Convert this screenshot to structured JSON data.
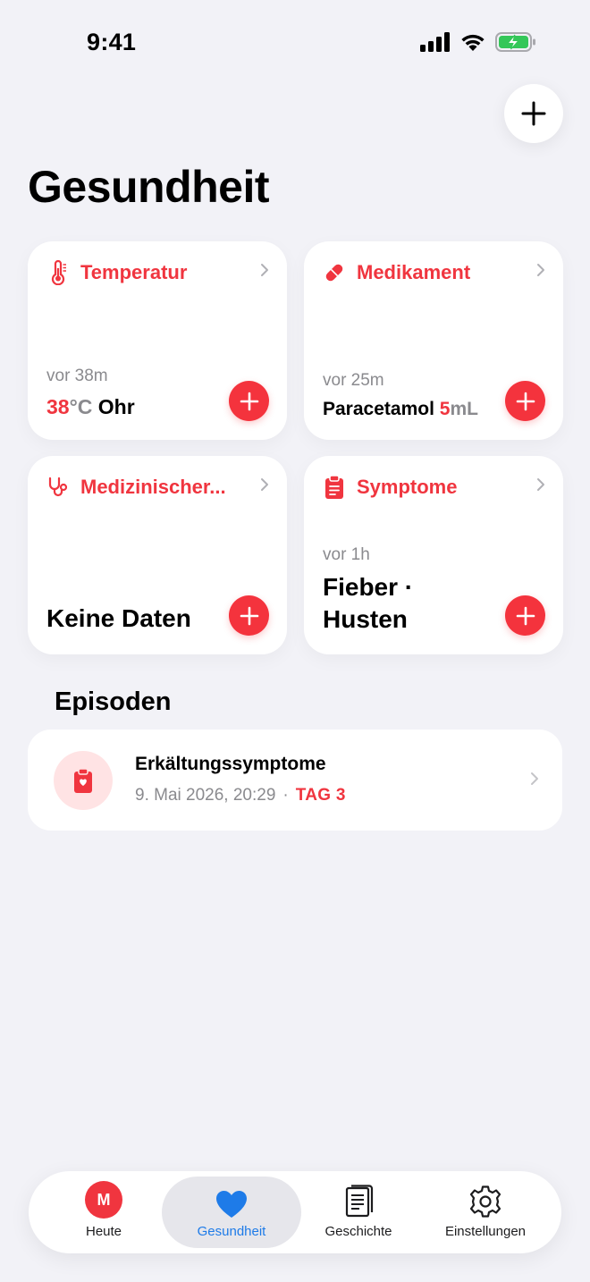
{
  "status_bar": {
    "time": "9:41"
  },
  "header": {
    "title": "Gesundheit"
  },
  "cards": [
    {
      "title": "Temperatur",
      "time": "vor 38m",
      "value_number": "38",
      "value_unit": "°C",
      "value_location": "Ohr"
    },
    {
      "title": "Medikament",
      "time": "vor 25m",
      "value_name": "Paracetamol",
      "value_amount": "5",
      "value_unit": "mL"
    },
    {
      "title": "Medizinischer...",
      "value_text": "Keine Daten"
    },
    {
      "title": "Symptome",
      "time": "vor 1h",
      "value_line1": "Fieber ·",
      "value_line2": "Husten"
    }
  ],
  "episodes": {
    "title": "Episoden",
    "items": [
      {
        "title": "Erkältungssymptome",
        "date": "9. Mai 2026, 20:29",
        "separator": "·",
        "day": "TAG 3"
      }
    ]
  },
  "tabbar": {
    "items": [
      {
        "label": "Heute",
        "avatar_letter": "M"
      },
      {
        "label": "Gesundheit",
        "active": true
      },
      {
        "label": "Geschichte"
      },
      {
        "label": "Einstellungen"
      }
    ]
  },
  "colors": {
    "accent": "#F0353F",
    "active_tab": "#1E7BE8",
    "background": "#F2F2F7"
  }
}
